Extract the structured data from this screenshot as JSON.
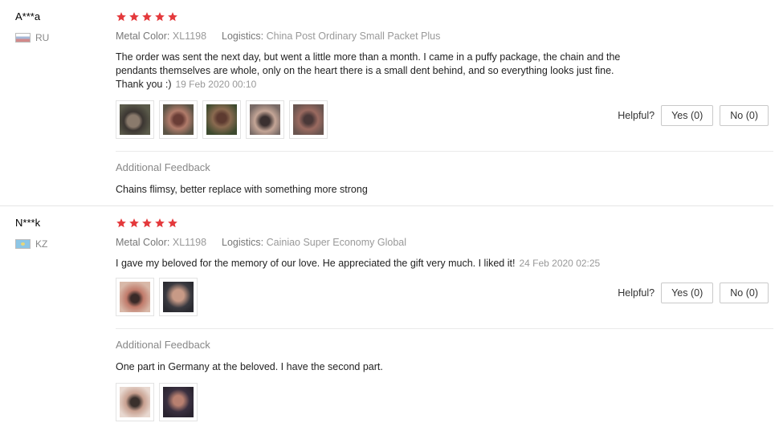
{
  "reviews": [
    {
      "user": "A***a",
      "country": "RU",
      "rating": 5,
      "metal_color_label": "Metal Color:",
      "metal_color": "XL1198",
      "logistics_label": "Logistics:",
      "logistics": "China Post Ordinary Small Packet Plus",
      "text_lines": [
        "The order was sent the next day, but went a little more than a month. I came in a puffy package, the chain and the",
        "pendants themselves are whole, only on the heart there is a small dent behind, and so everything looks just fine.",
        "Thank you :)"
      ],
      "date": "19 Feb 2020 00:10",
      "helpful_label": "Helpful?",
      "yes_label": "Yes (0)",
      "no_label": "No (0)",
      "additional_feedback_title": "Additional Feedback",
      "additional_feedback": "Chains flimsy, better replace with something more strong"
    },
    {
      "user": "N***k",
      "country": "KZ",
      "rating": 5,
      "metal_color_label": "Metal Color:",
      "metal_color": "XL1198",
      "logistics_label": "Logistics:",
      "logistics": "Cainiao Super Economy Global",
      "text": "I gave my beloved for the memory of our love. He appreciated the gift very much. I liked it!",
      "date": "24 Feb 2020 02:25",
      "helpful_label": "Helpful?",
      "yes_label": "Yes (0)",
      "no_label": "No (0)",
      "additional_feedback_title": "Additional Feedback",
      "additional_feedback": "One part in Germany at the beloved. I have the second part."
    }
  ],
  "colors": {
    "star": "#e4393c",
    "muted_text": "#999999",
    "border": "#c9c9c9"
  }
}
